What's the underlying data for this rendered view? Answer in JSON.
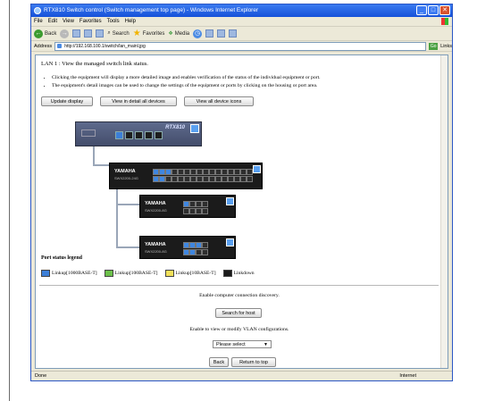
{
  "window": {
    "title": "RTX810 Switch control (Switch management top page) - Windows Internet Explorer",
    "buttons": {
      "minimize": "_",
      "maximize": "□",
      "close": "✕"
    }
  },
  "menu": [
    "File",
    "Edit",
    "View",
    "Favorites",
    "Tools",
    "Help"
  ],
  "toolbar": {
    "back": "Back",
    "forward": "→",
    "search": "Search",
    "favorites": "Favorites",
    "media": "Media"
  },
  "address": {
    "label": "Address",
    "url": "http://192.168.100.1/switch/lan_mainl.jpg",
    "go": "Go",
    "links": "Links"
  },
  "content": {
    "heading": "LAN 1 : View the managed switch link status.",
    "bullets": [
      "Clicking the equipment will display a more detailed image and enables verification of the status of the individual equipment or port.",
      "The equipment's detail images can be used to change the settings of the equipment or ports by clicking on the housing or port area."
    ],
    "buttons": {
      "update": "Update display",
      "detail_all": "View in detail all devices",
      "icons_all": "View all device icons"
    },
    "devices": {
      "router_label": "RTX810",
      "switch1_brand": "YAMAHA",
      "switch1_model": "SWX2200-24G",
      "switch2_brand": "YAMAHA",
      "switch2_model": "SWX2200-8G",
      "switch3_brand": "YAMAHA",
      "switch3_model": "SWX2200-8G"
    },
    "legend": {
      "title": "Port status legend",
      "items": [
        {
          "label": "Linkup[1000BASE-T]",
          "color": "#3c7fd8"
        },
        {
          "label": "Linkup[100BASE-T]",
          "color": "#6cc04a"
        },
        {
          "label": "Linkup[10BASE-T]",
          "color": "#f2e05a"
        },
        {
          "label": "Linkdown",
          "color": "#1a1a1a"
        }
      ]
    },
    "discovery": {
      "text": "Enable computer connection discovery.",
      "button": "Search for host"
    },
    "vlan": {
      "text": "Enable to view or modify VLAN configurations.",
      "select": "Please select"
    },
    "nav": {
      "back": "Back",
      "top": "Return to top"
    }
  },
  "status": {
    "left": "Done",
    "right": "Internet"
  }
}
